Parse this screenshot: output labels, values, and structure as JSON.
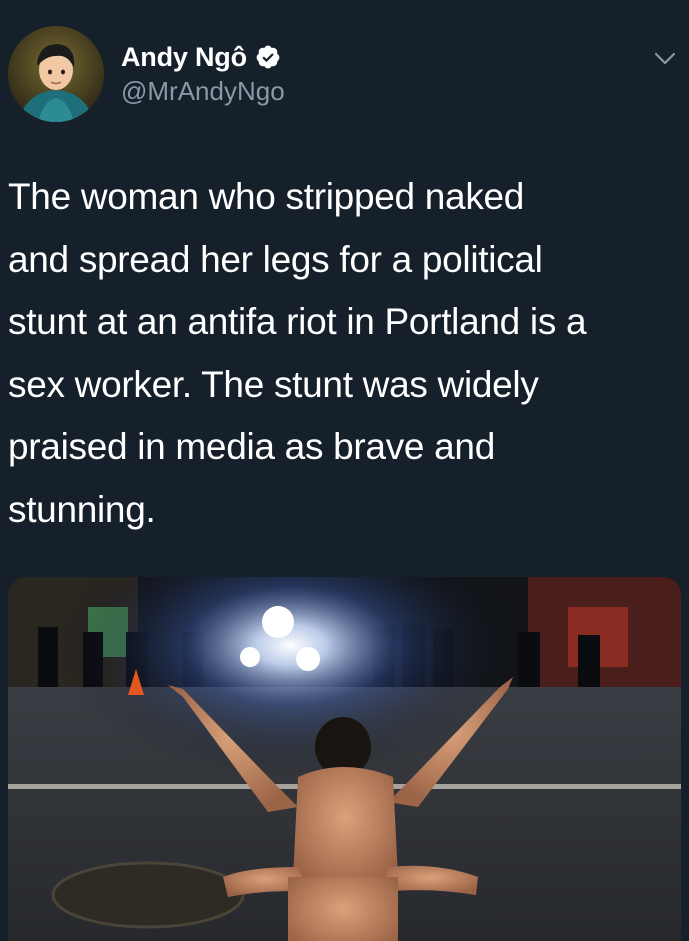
{
  "author": {
    "display_name": "Andy Ngô",
    "handle": "@MrAndyNgo",
    "verified": true,
    "avatar_icon": "avatar-illustration-icon"
  },
  "tweet": {
    "text": "The woman who stripped naked\nand spread her legs for a political\nstunt at an antifa riot in Portland is a\nsex worker. The stunt was widely\npraised in media as brave and\nstunning."
  },
  "media": {
    "type": "photo",
    "description_icon": "street-photo-icon"
  },
  "colors": {
    "background": "#15202b",
    "text": "#ffffff",
    "secondary_text": "#8899a6",
    "verified_badge": "#ffffff"
  }
}
